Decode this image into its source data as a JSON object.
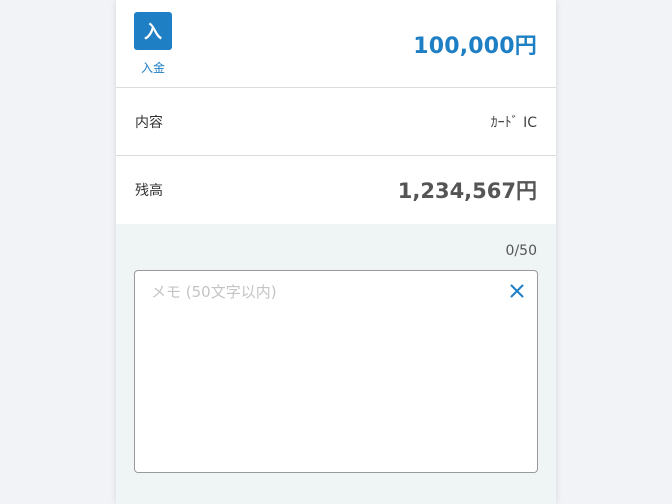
{
  "transaction": {
    "type_badge": "入",
    "type_label": "入金",
    "amount": "100,000円"
  },
  "content_row": {
    "label": "内容",
    "value": "ｶｰﾄﾞ IC"
  },
  "balance_row": {
    "label": "残高",
    "value": "1,234,567円"
  },
  "memo": {
    "counter": "0/50",
    "placeholder": "メモ (50文字以内)",
    "value": ""
  },
  "colors": {
    "accent": "#1e7fc4",
    "background": "#f1f3f7",
    "memo_background": "#eff4f4"
  },
  "icons": {
    "clear": "close-icon"
  }
}
